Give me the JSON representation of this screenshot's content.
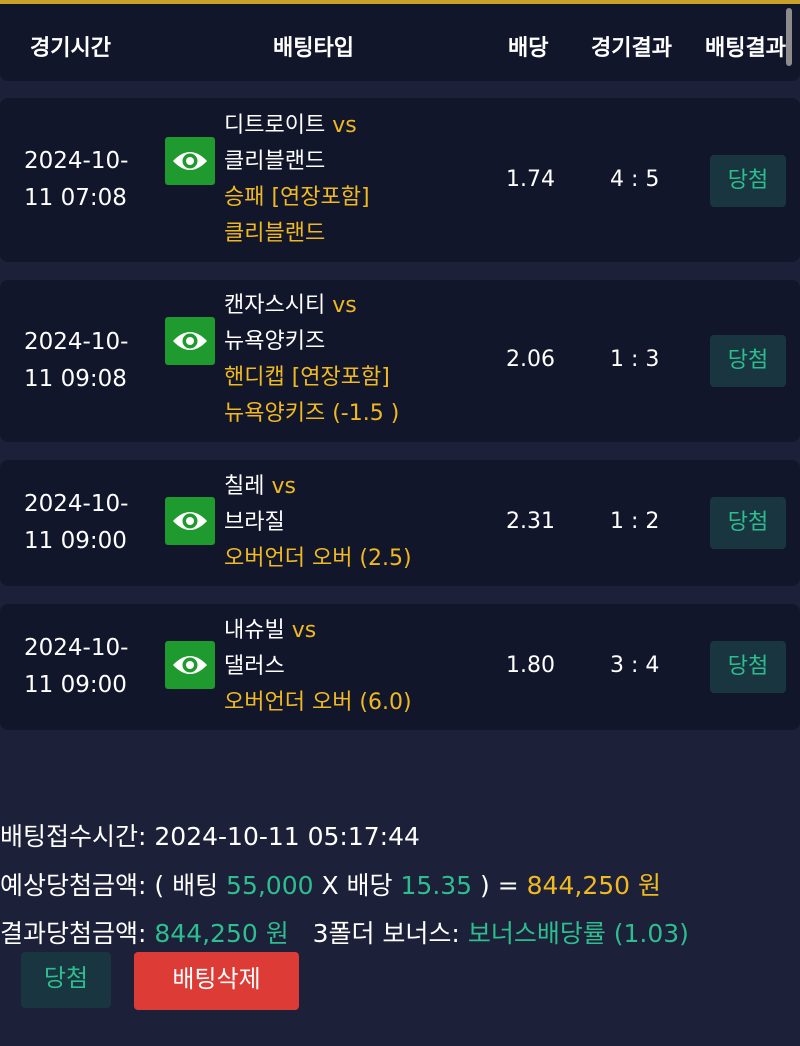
{
  "header": {
    "col_time": "경기시간",
    "col_bettype": "배팅타입",
    "col_odds": "배당",
    "col_score": "경기결과",
    "col_result": "배팅결과"
  },
  "icons": {
    "view": "eye-icon"
  },
  "colors": {
    "accent_gold": "#f0b920",
    "win_green": "#2dbd8e",
    "delete_red": "#dd3b36",
    "eye_green": "#1e9a2e"
  },
  "bets": [
    {
      "date": "2024-10-",
      "time": "11 07:08",
      "home": "디트로이트",
      "vs": "vs",
      "away": "클리블랜드",
      "market": "승패 [연장포함]",
      "pick": "클리블랜드",
      "odds": "1.74",
      "score": "4 : 5",
      "result": "당첨"
    },
    {
      "date": "2024-10-",
      "time": "11 09:08",
      "home": "캔자스시티",
      "vs": "vs",
      "away": "뉴욕양키즈",
      "market": "핸디캡 [연장포함]",
      "pick": "뉴욕양키즈 (-1.5 )",
      "odds": "2.06",
      "score": "1 : 3",
      "result": "당첨"
    },
    {
      "date": "2024-10-",
      "time": "11 09:00",
      "home": "칠레",
      "vs": "vs",
      "away": "브라질",
      "market": "오버언더 오버 (2.5)",
      "odds": "2.31",
      "score": "1 : 2",
      "result": "당첨"
    },
    {
      "date": "2024-10-",
      "time": "11 09:00",
      "home": "내슈빌",
      "vs": "vs",
      "away": "댈러스",
      "market": "오버언더 오버 (6.0)",
      "odds": "1.80",
      "score": "3 : 4",
      "result": "당첨"
    }
  ],
  "summary": {
    "receipt_label": "배팅접수시간:",
    "receipt_time": "2024-10-11 05:17:44",
    "expected_label": "예상당첨금액:",
    "expected_open": "( 배팅",
    "stake": "55,000",
    "times": "X 배당",
    "total_odds": "15.35",
    "expected_close": ") =",
    "expected_amount": "844,250 원",
    "actual_label": "결과당첨금액:",
    "actual_amount": "844,250 원",
    "bonus_label": "3폴더 보너스:",
    "bonus_value": "보너스배당률 (1.03)"
  },
  "buttons": {
    "win": "당첨",
    "delete": "배팅삭제"
  }
}
